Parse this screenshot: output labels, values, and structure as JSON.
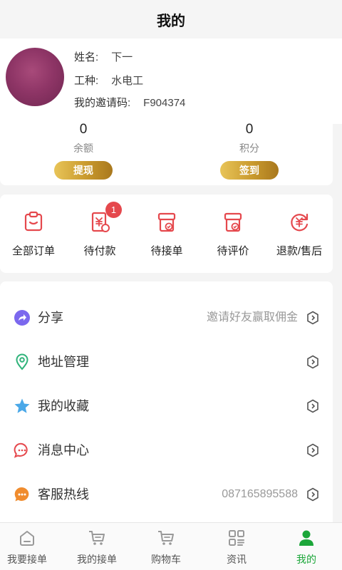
{
  "header": {
    "title": "我的"
  },
  "profile": {
    "name_key": "姓名:",
    "name_value": "下一",
    "job_key": "工种:",
    "job_value": "水电工",
    "code_key": "我的邀请码:",
    "code_value": "F904374"
  },
  "stats": {
    "balance": {
      "value": "0",
      "label": "余额",
      "button": "提现"
    },
    "points": {
      "value": "0",
      "label": "积分",
      "button": "签到"
    }
  },
  "orders": [
    {
      "label": "全部订单",
      "icon": "clipboard-icon"
    },
    {
      "label": "待付款",
      "icon": "yuan-bill-icon",
      "badge": "1"
    },
    {
      "label": "待接单",
      "icon": "box-check-icon"
    },
    {
      "label": "待评价",
      "icon": "box-check-icon"
    },
    {
      "label": "退款/售后",
      "icon": "refund-icon"
    }
  ],
  "menu": [
    {
      "label": "分享",
      "value": "邀请好友赢取佣金",
      "icon": "share-icon"
    },
    {
      "label": "地址管理",
      "value": "",
      "icon": "location-icon"
    },
    {
      "label": "我的收藏",
      "value": "",
      "icon": "star-icon"
    },
    {
      "label": "消息中心",
      "value": "",
      "icon": "message-icon"
    },
    {
      "label": "客服热线",
      "value": "087165895588",
      "icon": "hotline-icon"
    }
  ],
  "tabbar": [
    {
      "label": "我要接单",
      "icon": "home-icon"
    },
    {
      "label": "我的接单",
      "icon": "cart-icon"
    },
    {
      "label": "购物车",
      "icon": "cart-icon"
    },
    {
      "label": "资讯",
      "icon": "grid-icon"
    },
    {
      "label": "我的",
      "icon": "user-icon",
      "active": true
    }
  ],
  "colors": {
    "accent_red": "#e5484d",
    "gold": "#c99a2e",
    "active_green": "#1ba639"
  }
}
